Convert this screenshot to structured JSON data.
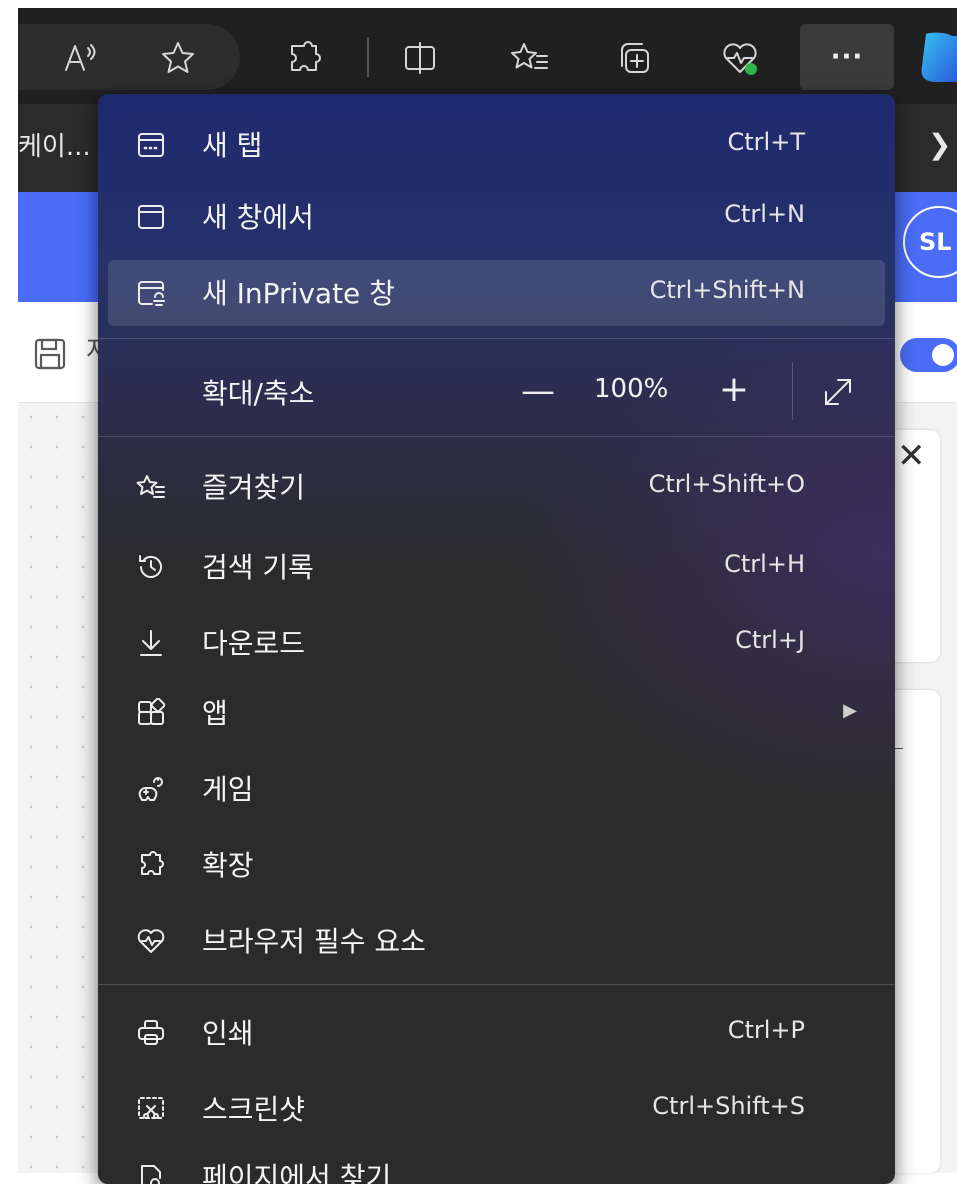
{
  "favorites_bar": {
    "truncated_item": "케이...",
    "overflow_chevron": "❯"
  },
  "profile": {
    "initials": "SL"
  },
  "page": {
    "toolbar_letter": "저"
  },
  "toolbar": {
    "more_label": "···"
  },
  "menu": {
    "groups": [
      [
        {
          "label": "새 탭",
          "shortcut": "Ctrl+T",
          "icon": "new-tab-icon"
        },
        {
          "label": "새 창에서",
          "shortcut": "Ctrl+N",
          "icon": "window-icon"
        },
        {
          "label": "새 InPrivate 창",
          "shortcut": "Ctrl+Shift+N",
          "icon": "inprivate-icon"
        }
      ],
      [
        {
          "label": "즐겨찾기",
          "shortcut": "Ctrl+Shift+O",
          "icon": "favorites-icon"
        },
        {
          "label": "검색 기록",
          "shortcut": "Ctrl+H",
          "icon": "history-icon"
        },
        {
          "label": "다운로드",
          "shortcut": "Ctrl+J",
          "icon": "download-icon"
        },
        {
          "label": "앱",
          "shortcut": "",
          "icon": "apps-icon",
          "submenu_arrow": "▶"
        },
        {
          "label": "게임",
          "shortcut": "",
          "icon": "games-icon"
        },
        {
          "label": "확장",
          "shortcut": "",
          "icon": "extensions-icon"
        },
        {
          "label": "브라우저 필수 요소",
          "shortcut": "",
          "icon": "browser-essentials-icon"
        }
      ],
      [
        {
          "label": "인쇄",
          "shortcut": "Ctrl+P",
          "icon": "print-icon"
        },
        {
          "label": "스크린샷",
          "shortcut": "Ctrl+Shift+S",
          "icon": "screenshot-icon"
        },
        {
          "label": "페이지에서 찾기",
          "shortcut": "",
          "icon": "find-icon"
        }
      ]
    ],
    "zoom": {
      "label": "확대/축소",
      "value": "100%",
      "minus": "—",
      "plus": "+"
    }
  },
  "colors": {
    "menu_bg": "#2b2b2b",
    "menu_top": "#1e2a6e",
    "accent": "#4a6cf7"
  }
}
